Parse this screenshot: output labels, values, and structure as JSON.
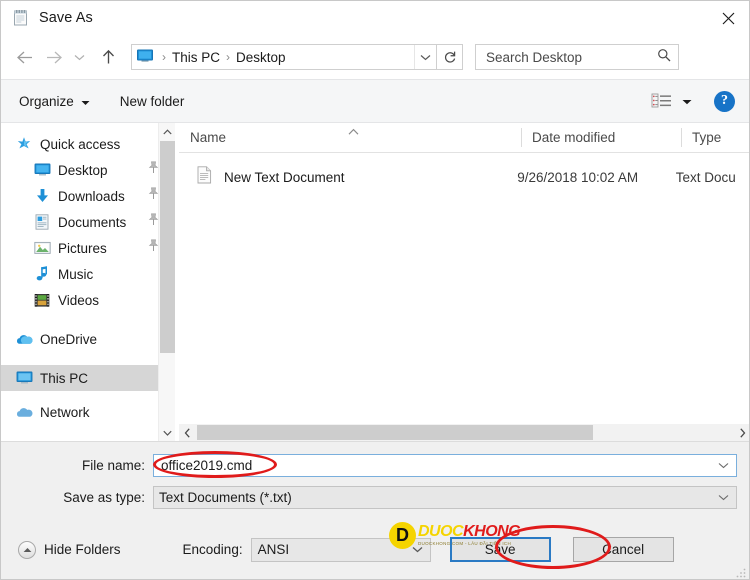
{
  "window": {
    "title": "Save As",
    "icon": "notepad-icon",
    "close_label": "✕"
  },
  "navbar": {
    "back_icon": "arrow-left-icon",
    "forward_icon": "arrow-right-icon",
    "history_icon": "chevron-down-icon",
    "up_icon": "arrow-up-icon",
    "address": {
      "location_icon": "this-pc-icon",
      "crumbs": [
        "This PC",
        "Desktop"
      ],
      "separator": "›",
      "dropdown_icon": "chevron-down-icon"
    },
    "refresh_icon": "refresh-icon",
    "search": {
      "placeholder": "Search Desktop",
      "value": "",
      "icon": "search-icon"
    }
  },
  "toolbar": {
    "organize_label": "Organize",
    "organize_caret": "▼",
    "new_folder_label": "New folder",
    "view_icon": "list-view-icon",
    "view_caret": "▼",
    "help_label": "?",
    "help_icon": "help-icon"
  },
  "sidebar": {
    "items": [
      {
        "label": "Quick access",
        "icon": "star-icon",
        "level": 0,
        "pinned": false,
        "selected": false
      },
      {
        "label": "Desktop",
        "icon": "desktop-icon",
        "level": 1,
        "pinned": true,
        "selected": false
      },
      {
        "label": "Downloads",
        "icon": "download-icon",
        "level": 1,
        "pinned": true,
        "selected": false
      },
      {
        "label": "Documents",
        "icon": "documents-icon",
        "level": 1,
        "pinned": true,
        "selected": false
      },
      {
        "label": "Pictures",
        "icon": "pictures-icon",
        "level": 1,
        "pinned": true,
        "selected": false
      },
      {
        "label": "Music",
        "icon": "music-icon",
        "level": 1,
        "pinned": false,
        "selected": false
      },
      {
        "label": "Videos",
        "icon": "videos-icon",
        "level": 1,
        "pinned": false,
        "selected": false
      },
      {
        "label": "OneDrive",
        "icon": "onedrive-icon",
        "level": 0,
        "pinned": false,
        "selected": false
      },
      {
        "label": "This PC",
        "icon": "this-pc-icon",
        "level": 0,
        "pinned": false,
        "selected": true
      },
      {
        "label": "Network",
        "icon": "network-icon",
        "level": 0,
        "pinned": false,
        "selected": false
      }
    ],
    "pin_icon": "pin-icon",
    "scroll_up_icon": "chevron-up-icon",
    "scroll_down_icon": "chevron-down-icon"
  },
  "filelist": {
    "columns": [
      "Name",
      "Date modified",
      "Type"
    ],
    "sort_indicator": "⌃",
    "rows": [
      {
        "icon": "text-file-icon",
        "name": "New Text Document",
        "date_modified": "9/26/2018 10:02 AM",
        "type": "Text Docu"
      }
    ],
    "hscroll_left_icon": "chevron-left-icon",
    "hscroll_right_icon": "chevron-right-icon"
  },
  "form": {
    "filename_label": "File name:",
    "filename_value": "office2019.cmd",
    "savetype_label": "Save as type:",
    "savetype_value": "Text Documents (*.txt)",
    "combo_caret": "⌄",
    "hide_folders_label": "Hide Folders",
    "hide_folders_icon": "chevron-up-circle-icon",
    "encoding_label": "Encoding:",
    "encoding_value": "ANSI",
    "save_label": "Save",
    "cancel_label": "Cancel",
    "resize_grip_icon": "resize-grip-icon"
  },
  "annotations": [
    {
      "name": "filename-highlight",
      "shape": "ellipse",
      "color": "#e01b1b",
      "target": "filename-field"
    },
    {
      "name": "save-button-highlight",
      "shape": "ellipse",
      "color": "#e01b1b",
      "target": "save-button"
    }
  ],
  "watermark": {
    "badge": "D",
    "text_primary": "DUOC",
    "text_secondary": "KHONG",
    "subtitle": "DUOCKHONG.COM - LÂU ĐẦI TIỀN ICH",
    "badge_color": "#f5d400",
    "text_color": "#e01b1b"
  },
  "colors": {
    "accent": "#1773c7",
    "annotation_red": "#e01b1b",
    "toolbar_bg": "#f5f6f7",
    "form_bg": "#f0f0f0",
    "selection_bg": "#d6d6d6",
    "focus_border": "#2a7ac4"
  }
}
